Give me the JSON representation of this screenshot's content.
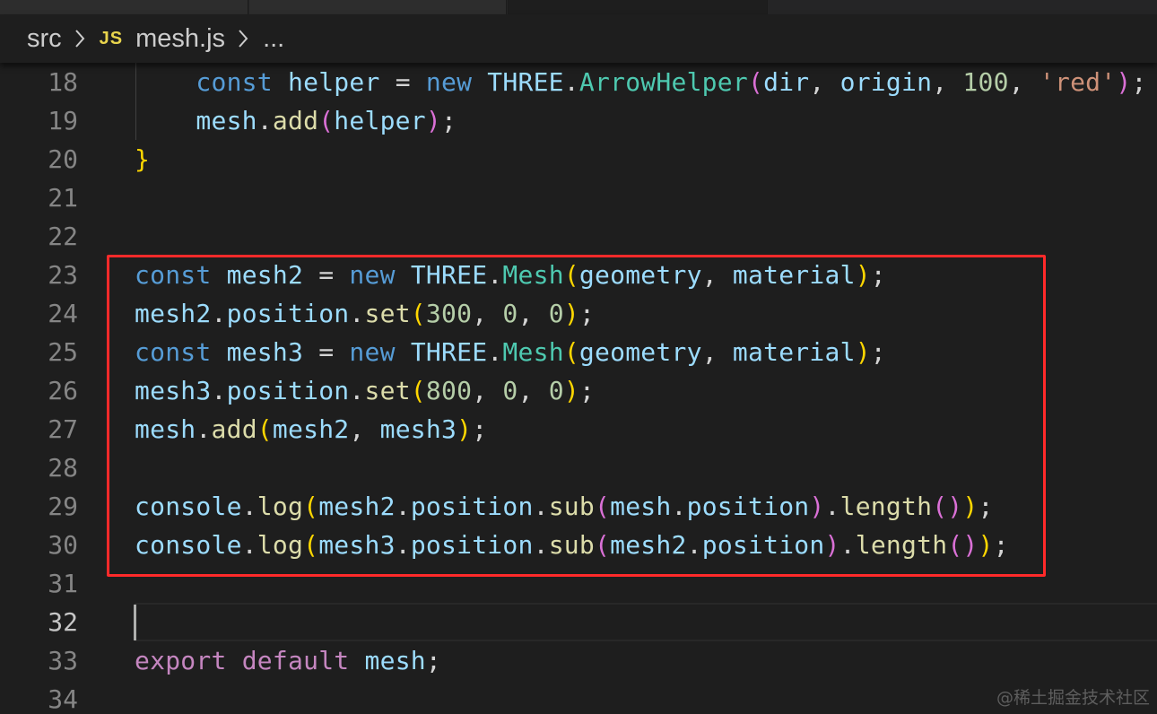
{
  "breadcrumb": {
    "folder": "src",
    "file_icon_text": "JS",
    "file": "mesh.js",
    "ellipsis": "..."
  },
  "editor": {
    "lines": [
      {
        "number": "18",
        "tokens": [
          {
            "t": "    ",
            "c": "p"
          },
          {
            "t": "const",
            "c": "kw"
          },
          {
            "t": " ",
            "c": "p"
          },
          {
            "t": "helper",
            "c": "var"
          },
          {
            "t": " = ",
            "c": "p"
          },
          {
            "t": "new",
            "c": "kw"
          },
          {
            "t": " ",
            "c": "p"
          },
          {
            "t": "THREE",
            "c": "var"
          },
          {
            "t": ".",
            "c": "p"
          },
          {
            "t": "ArrowHelper",
            "c": "cls"
          },
          {
            "t": "(",
            "c": "b2"
          },
          {
            "t": "dir",
            "c": "var"
          },
          {
            "t": ", ",
            "c": "p"
          },
          {
            "t": "origin",
            "c": "var"
          },
          {
            "t": ", ",
            "c": "p"
          },
          {
            "t": "100",
            "c": "num"
          },
          {
            "t": ", ",
            "c": "p"
          },
          {
            "t": "'red'",
            "c": "str"
          },
          {
            "t": ")",
            "c": "b2"
          },
          {
            "t": ";",
            "c": "p"
          }
        ]
      },
      {
        "number": "19",
        "tokens": [
          {
            "t": "    ",
            "c": "p"
          },
          {
            "t": "mesh",
            "c": "var"
          },
          {
            "t": ".",
            "c": "p"
          },
          {
            "t": "add",
            "c": "fn"
          },
          {
            "t": "(",
            "c": "b2"
          },
          {
            "t": "helper",
            "c": "var"
          },
          {
            "t": ")",
            "c": "b2"
          },
          {
            "t": ";",
            "c": "p"
          }
        ]
      },
      {
        "number": "20",
        "tokens": [
          {
            "t": "}",
            "c": "b1"
          }
        ]
      },
      {
        "number": "21",
        "tokens": []
      },
      {
        "number": "22",
        "tokens": []
      },
      {
        "number": "23",
        "tokens": [
          {
            "t": "const",
            "c": "kw"
          },
          {
            "t": " ",
            "c": "p"
          },
          {
            "t": "mesh2",
            "c": "var"
          },
          {
            "t": " = ",
            "c": "p"
          },
          {
            "t": "new",
            "c": "kw"
          },
          {
            "t": " ",
            "c": "p"
          },
          {
            "t": "THREE",
            "c": "var"
          },
          {
            "t": ".",
            "c": "p"
          },
          {
            "t": "Mesh",
            "c": "cls"
          },
          {
            "t": "(",
            "c": "b1"
          },
          {
            "t": "geometry",
            "c": "var"
          },
          {
            "t": ", ",
            "c": "p"
          },
          {
            "t": "material",
            "c": "var"
          },
          {
            "t": ")",
            "c": "b1"
          },
          {
            "t": ";",
            "c": "p"
          }
        ]
      },
      {
        "number": "24",
        "tokens": [
          {
            "t": "mesh2",
            "c": "var"
          },
          {
            "t": ".",
            "c": "p"
          },
          {
            "t": "position",
            "c": "var"
          },
          {
            "t": ".",
            "c": "p"
          },
          {
            "t": "set",
            "c": "fn"
          },
          {
            "t": "(",
            "c": "b1"
          },
          {
            "t": "300",
            "c": "num"
          },
          {
            "t": ", ",
            "c": "p"
          },
          {
            "t": "0",
            "c": "num"
          },
          {
            "t": ", ",
            "c": "p"
          },
          {
            "t": "0",
            "c": "num"
          },
          {
            "t": ")",
            "c": "b1"
          },
          {
            "t": ";",
            "c": "p"
          }
        ]
      },
      {
        "number": "25",
        "tokens": [
          {
            "t": "const",
            "c": "kw"
          },
          {
            "t": " ",
            "c": "p"
          },
          {
            "t": "mesh3",
            "c": "var"
          },
          {
            "t": " = ",
            "c": "p"
          },
          {
            "t": "new",
            "c": "kw"
          },
          {
            "t": " ",
            "c": "p"
          },
          {
            "t": "THREE",
            "c": "var"
          },
          {
            "t": ".",
            "c": "p"
          },
          {
            "t": "Mesh",
            "c": "cls"
          },
          {
            "t": "(",
            "c": "b1"
          },
          {
            "t": "geometry",
            "c": "var"
          },
          {
            "t": ", ",
            "c": "p"
          },
          {
            "t": "material",
            "c": "var"
          },
          {
            "t": ")",
            "c": "b1"
          },
          {
            "t": ";",
            "c": "p"
          }
        ]
      },
      {
        "number": "26",
        "tokens": [
          {
            "t": "mesh3",
            "c": "var"
          },
          {
            "t": ".",
            "c": "p"
          },
          {
            "t": "position",
            "c": "var"
          },
          {
            "t": ".",
            "c": "p"
          },
          {
            "t": "set",
            "c": "fn"
          },
          {
            "t": "(",
            "c": "b1"
          },
          {
            "t": "800",
            "c": "num"
          },
          {
            "t": ", ",
            "c": "p"
          },
          {
            "t": "0",
            "c": "num"
          },
          {
            "t": ", ",
            "c": "p"
          },
          {
            "t": "0",
            "c": "num"
          },
          {
            "t": ")",
            "c": "b1"
          },
          {
            "t": ";",
            "c": "p"
          }
        ]
      },
      {
        "number": "27",
        "tokens": [
          {
            "t": "mesh",
            "c": "var"
          },
          {
            "t": ".",
            "c": "p"
          },
          {
            "t": "add",
            "c": "fn"
          },
          {
            "t": "(",
            "c": "b1"
          },
          {
            "t": "mesh2",
            "c": "var"
          },
          {
            "t": ", ",
            "c": "p"
          },
          {
            "t": "mesh3",
            "c": "var"
          },
          {
            "t": ")",
            "c": "b1"
          },
          {
            "t": ";",
            "c": "p"
          }
        ]
      },
      {
        "number": "28",
        "tokens": []
      },
      {
        "number": "29",
        "tokens": [
          {
            "t": "console",
            "c": "var"
          },
          {
            "t": ".",
            "c": "p"
          },
          {
            "t": "log",
            "c": "fn"
          },
          {
            "t": "(",
            "c": "b1"
          },
          {
            "t": "mesh2",
            "c": "var"
          },
          {
            "t": ".",
            "c": "p"
          },
          {
            "t": "position",
            "c": "var"
          },
          {
            "t": ".",
            "c": "p"
          },
          {
            "t": "sub",
            "c": "fn"
          },
          {
            "t": "(",
            "c": "b2"
          },
          {
            "t": "mesh",
            "c": "var"
          },
          {
            "t": ".",
            "c": "p"
          },
          {
            "t": "position",
            "c": "var"
          },
          {
            "t": ")",
            "c": "b2"
          },
          {
            "t": ".",
            "c": "p"
          },
          {
            "t": "length",
            "c": "fn"
          },
          {
            "t": "()",
            "c": "b2"
          },
          {
            "t": ")",
            "c": "b1"
          },
          {
            "t": ";",
            "c": "p"
          }
        ]
      },
      {
        "number": "30",
        "tokens": [
          {
            "t": "console",
            "c": "var"
          },
          {
            "t": ".",
            "c": "p"
          },
          {
            "t": "log",
            "c": "fn"
          },
          {
            "t": "(",
            "c": "b1"
          },
          {
            "t": "mesh3",
            "c": "var"
          },
          {
            "t": ".",
            "c": "p"
          },
          {
            "t": "position",
            "c": "var"
          },
          {
            "t": ".",
            "c": "p"
          },
          {
            "t": "sub",
            "c": "fn"
          },
          {
            "t": "(",
            "c": "b2"
          },
          {
            "t": "mesh2",
            "c": "var"
          },
          {
            "t": ".",
            "c": "p"
          },
          {
            "t": "position",
            "c": "var"
          },
          {
            "t": ")",
            "c": "b2"
          },
          {
            "t": ".",
            "c": "p"
          },
          {
            "t": "length",
            "c": "fn"
          },
          {
            "t": "()",
            "c": "b2"
          },
          {
            "t": ")",
            "c": "b1"
          },
          {
            "t": ";",
            "c": "p"
          }
        ]
      },
      {
        "number": "31",
        "tokens": []
      },
      {
        "number": "32",
        "tokens": [],
        "current": true
      },
      {
        "number": "33",
        "tokens": [
          {
            "t": "export",
            "c": "kw2"
          },
          {
            "t": " ",
            "c": "p"
          },
          {
            "t": "default",
            "c": "kw2"
          },
          {
            "t": " ",
            "c": "p"
          },
          {
            "t": "mesh",
            "c": "var"
          },
          {
            "t": ";",
            "c": "p"
          }
        ]
      },
      {
        "number": "34",
        "tokens": []
      }
    ]
  },
  "watermark": "@稀土掘金技术社区"
}
